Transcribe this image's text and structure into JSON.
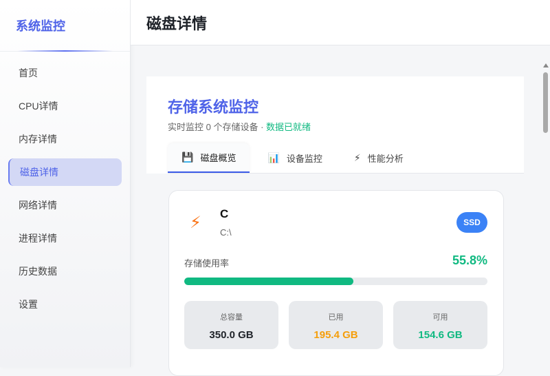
{
  "sidebar": {
    "brand": "系统监控",
    "items": [
      {
        "label": "首页"
      },
      {
        "label": "CPU详情"
      },
      {
        "label": "内存详情"
      },
      {
        "label": "磁盘详情",
        "active": true
      },
      {
        "label": "网络详情"
      },
      {
        "label": "进程详情"
      },
      {
        "label": "历史数据"
      },
      {
        "label": "设置"
      }
    ]
  },
  "header": {
    "title": "磁盘详情"
  },
  "panel": {
    "title": "存储系统监控",
    "subtitle": "实时监控 0 个存储设备 · ",
    "status": "数据已就绪",
    "tabs": [
      {
        "icon": "floppy-disk-icon",
        "glyph": "💾",
        "label": "磁盘概览"
      },
      {
        "icon": "bar-chart-icon",
        "glyph": "📊",
        "label": "设备监控"
      },
      {
        "icon": "lightning-icon",
        "glyph": "⚡",
        "label": "性能分析"
      }
    ]
  },
  "disk": {
    "name": "C",
    "path": "C:\\",
    "type": "SSD",
    "usage_label": "存储使用率",
    "usage_text": "55.8%",
    "usage_percent": 55.8,
    "stats": [
      {
        "label": "总容量",
        "value": "350.0 GB",
        "color": "#1f2329"
      },
      {
        "label": "已用",
        "value": "195.4 GB",
        "color": "#f59e0b"
      },
      {
        "label": "可用",
        "value": "154.6 GB",
        "color": "#10b981"
      }
    ]
  },
  "colors": {
    "accent": "#4f63e8",
    "success": "#10b981",
    "warning": "#f59e0b",
    "badge": "#3b82f6"
  }
}
